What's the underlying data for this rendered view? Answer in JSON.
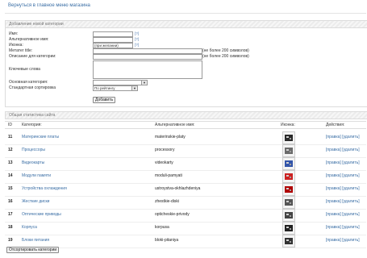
{
  "back_link": "Вернуться в главное меню магазина",
  "add_form": {
    "title": "Добавление новой категории",
    "fields": {
      "name": {
        "label": "Имя:",
        "hint": "[?]"
      },
      "alt_name": {
        "label": "Альтернативное имя:",
        "hint": "[?]"
      },
      "icon": {
        "label": "Иконка:",
        "value": "(при желании)",
        "hint": "[?]"
      },
      "meta_title": {
        "label": "Метатег title:",
        "note": "(не более 200 символов)"
      },
      "meta_desc": {
        "label": "Описание для категории:",
        "note": "(не более 200 символов)"
      },
      "keywords": {
        "label": "Ключевые слова"
      },
      "parent": {
        "label": "Основная категория:"
      },
      "sort": {
        "label": "Стандартная сортировка",
        "value": "По рейтингу"
      }
    },
    "submit": "Добавить"
  },
  "list": {
    "title": "Общая статистика сайта",
    "columns": {
      "id": "ID",
      "category": "Категория:",
      "alias": "Альтернативное имя:",
      "icon": "Иконка:",
      "actions": "Действия:"
    },
    "edit_label": "[правка]",
    "delete_label": "[удалить]",
    "rows": [
      {
        "id": "11",
        "name": "Материнские платы",
        "alias": "materinskie-platy",
        "icon": "motherboard-icon"
      },
      {
        "id": "12",
        "name": "Процессоры",
        "alias": "processory",
        "icon": "cpu-icon"
      },
      {
        "id": "13",
        "name": "Видеокарты",
        "alias": "videokarty",
        "icon": "graphics-card-icon"
      },
      {
        "id": "14",
        "name": "Модули памяти",
        "alias": "moduli-pamyati",
        "icon": "memory-module-icon"
      },
      {
        "id": "15",
        "name": "Устройства охлаждения",
        "alias": "ustroystva-okhlazhdeniya",
        "icon": "cooler-icon"
      },
      {
        "id": "16",
        "name": "Жесткие диски",
        "alias": "zhestkie-diski",
        "icon": "hard-disk-icon"
      },
      {
        "id": "17",
        "name": "Оптические приводы",
        "alias": "opticheskie-privody",
        "icon": "optical-drive-icon"
      },
      {
        "id": "18",
        "name": "Корпуса",
        "alias": "korpusa",
        "icon": "pc-case-icon"
      },
      {
        "id": "19",
        "name": "Блоки питания",
        "alias": "bloki-pitaniya",
        "icon": "power-supply-icon"
      }
    ],
    "sort_button": "Отсортировать категории"
  }
}
